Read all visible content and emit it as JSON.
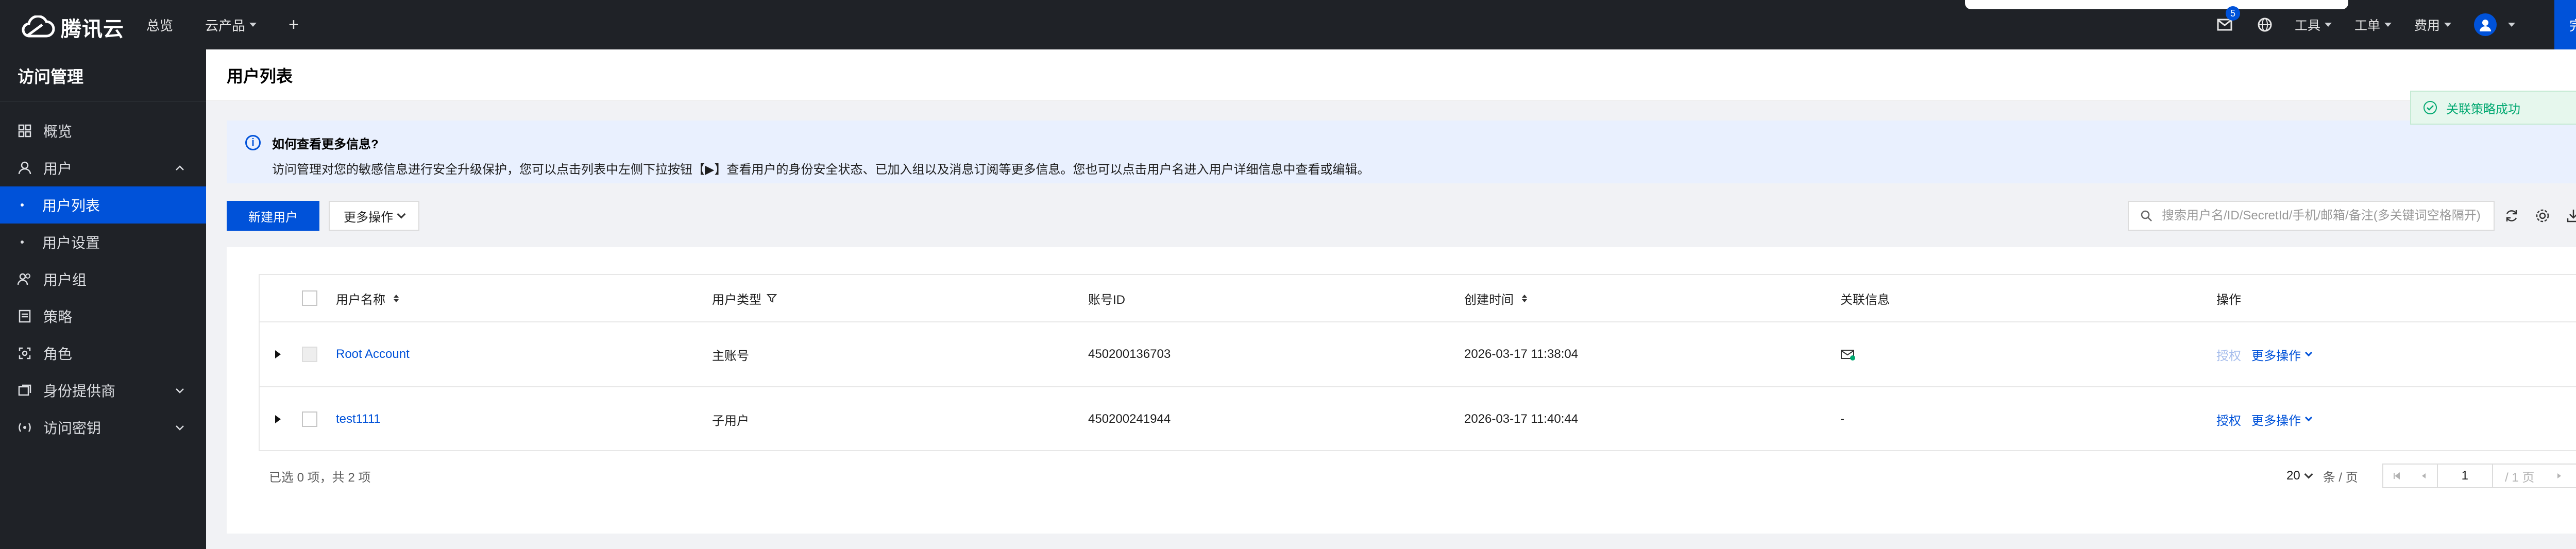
{
  "topbar": {
    "brand": "腾讯云",
    "nav": [
      {
        "label": "总览"
      },
      {
        "label": "云产品"
      }
    ],
    "add_symbol": "+",
    "mail_badge": "5",
    "right_menu": [
      {
        "label": "工具"
      },
      {
        "label": "工单"
      },
      {
        "label": "费用"
      }
    ],
    "register_label": "完成注册"
  },
  "sidebar": {
    "title": "访问管理",
    "items": [
      {
        "label": "概览",
        "icon": "grid-icon"
      },
      {
        "label": "用户",
        "icon": "user-icon"
      },
      {
        "label": "用户列表"
      },
      {
        "label": "用户设置"
      },
      {
        "label": "用户组",
        "icon": "user-group-icon"
      },
      {
        "label": "策略",
        "icon": "policy-icon"
      },
      {
        "label": "角色",
        "icon": "role-icon"
      },
      {
        "label": "身份提供商",
        "icon": "identity-provider-icon"
      },
      {
        "label": "访问密钥",
        "icon": "key-icon"
      }
    ]
  },
  "page": {
    "title": "用户列表"
  },
  "info": {
    "title": "如何查看更多信息?",
    "text": "访问管理对您的敏感信息进行安全升级保护，您可以点击列表中左侧下拉按钮【▶】查看用户的身份安全状态、已加入组以及消息订阅等更多信息。您也可以点击用户名进入用户详细信息中查看或编辑。"
  },
  "toolbar": {
    "new_user": "新建用户",
    "more_actions": "更多操作",
    "search_placeholder": "搜索用户名/ID/SecretId/手机/邮箱/备注(多关键词空格隔开)"
  },
  "table": {
    "columns": [
      "用户名称",
      "用户类型",
      "账号ID",
      "创建时间",
      "关联信息",
      "操作"
    ],
    "rows": [
      {
        "name": "Root Account",
        "type": "主账号",
        "account_id": "450200136703",
        "created": "2026-03-17 11:38:04",
        "assoc": "mail",
        "action": "授权",
        "more": "更多操作"
      },
      {
        "name": "test1111",
        "type": "子用户",
        "account_id": "450200241944",
        "created": "2026-03-17 11:40:44",
        "assoc": "-",
        "action": "授权",
        "more": "更多操作"
      }
    ]
  },
  "footer": {
    "selection": "已选 0 项，共 2 项",
    "page_size": "20",
    "page_size_unit": "条 / 页",
    "page": "1",
    "total_pages": "/ 1 页"
  },
  "toast": {
    "message": "关联策略成功",
    "close": "×"
  },
  "colors": {
    "brand": "#0052d9",
    "dark": "#1f2227",
    "success": "#00a870",
    "info_bg": "#e9f0fe"
  }
}
